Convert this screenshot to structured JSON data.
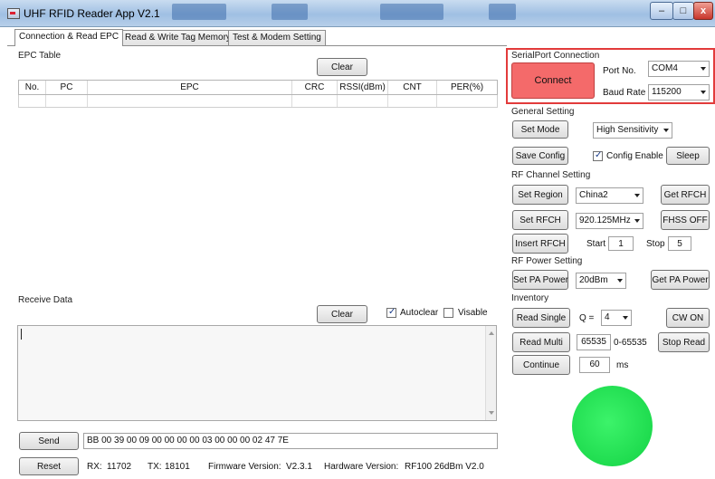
{
  "window": {
    "title": "UHF RFID Reader App V2.1",
    "controls": {
      "minimize": "–",
      "maximize": "□",
      "close": "x"
    }
  },
  "tabs": [
    {
      "label": "Connection & Read EPC",
      "active": true
    },
    {
      "label": "Read & Write Tag Memory",
      "active": false
    },
    {
      "label": "Test & Modem Setting",
      "active": false
    }
  ],
  "epc_table": {
    "title": "EPC Table",
    "clear_label": "Clear",
    "columns": [
      "No.",
      "PC",
      "EPC",
      "CRC",
      "RSSI(dBm)",
      "CNT",
      "PER(%)"
    ]
  },
  "receive": {
    "title": "Receive Data",
    "clear_label": "Clear",
    "autoclear_label": "Autoclear",
    "autoclear_checked": true,
    "visable_label": "Visable",
    "visable_checked": false,
    "content": ""
  },
  "send": {
    "button_label": "Send",
    "command": "BB 00 39 00 09 00 00 00 00 03 00 00 00 02 47 7E"
  },
  "status_bar": {
    "reset_label": "Reset",
    "rx_label": "RX:",
    "rx_value": "11702",
    "tx_label": "TX:",
    "tx_value": "18101",
    "firmware_label": "Firmware Version:",
    "firmware_value": "V2.3.1",
    "hardware_label": "Hardware Version:",
    "hardware_value": "RF100 26dBm V2.0"
  },
  "serial": {
    "title": "SerialPort Connection",
    "connect_label": "Connect",
    "connect_color": "#f46a6a",
    "highlight_color": "#e23b3b",
    "port_label": "Port No.",
    "port_value": "COM4",
    "baud_label": "Baud Rate",
    "baud_value": "115200"
  },
  "general": {
    "title": "General Setting",
    "set_mode_label": "Set Mode",
    "mode_value": "High Sensitivity",
    "save_config_label": "Save Config",
    "config_enable_label": "Config Enable",
    "config_enable_checked": true,
    "sleep_label": "Sleep"
  },
  "rf_channel": {
    "title": "RF Channel Setting",
    "set_region_label": "Set Region",
    "region_value": "China2",
    "get_rfch_label": "Get RFCH",
    "set_rfch_label": "Set RFCH",
    "freq_value": "920.125MHz",
    "fhss_label": "FHSS OFF",
    "insert_rfch_label": "Insert RFCH",
    "start_label": "Start",
    "start_value": "1",
    "stop_label": "Stop",
    "stop_value": "5"
  },
  "rf_power": {
    "title": "RF Power Setting",
    "set_pa_label": "Set PA Power",
    "power_value": "20dBm",
    "get_pa_label": "Get PA Power"
  },
  "inventory": {
    "title": "Inventory",
    "read_single_label": "Read Single",
    "q_label": "Q =",
    "q_value": "4",
    "cw_on_label": "CW ON",
    "read_multi_label": "Read Multi",
    "multi_value": "65535",
    "range_label": "0-65535",
    "stop_read_label": "Stop Read",
    "continue_label": "Continue",
    "interval_value": "60",
    "interval_unit": "ms"
  },
  "indicator": {
    "color": "#1fdc4f"
  }
}
